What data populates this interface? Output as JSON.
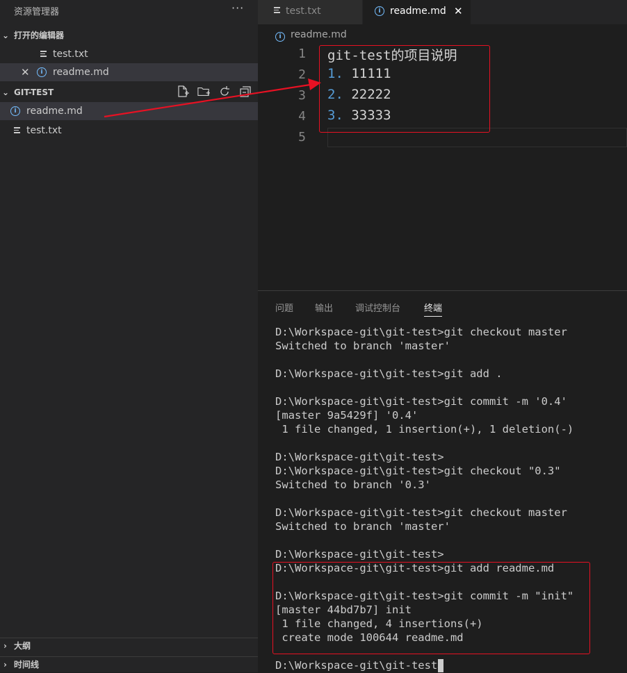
{
  "explorer": {
    "title": "资源管理器",
    "more_label": "···",
    "open_editors": {
      "header": "打开的编辑器",
      "items": [
        {
          "name": "test.txt",
          "icon": "file-lines-icon"
        },
        {
          "name": "readme.md",
          "icon": "info-icon",
          "active": true
        }
      ]
    },
    "workspace": {
      "header": "GIT-TEST",
      "files": [
        {
          "name": "readme.md",
          "icon": "info-icon"
        },
        {
          "name": "test.txt",
          "icon": "file-lines-icon"
        }
      ]
    },
    "outline": "大纲",
    "timeline": "时间线"
  },
  "editor": {
    "tabs": [
      {
        "label": "test.txt",
        "active": false
      },
      {
        "label": "readme.md",
        "active": true
      }
    ],
    "breadcrumb": "readme.md",
    "lines": [
      {
        "no": "1",
        "num": "",
        "text": "git-test的项目说明"
      },
      {
        "no": "2",
        "num": "1.",
        "text": " 11111"
      },
      {
        "no": "3",
        "num": "2.",
        "text": " 22222"
      },
      {
        "no": "4",
        "num": "3.",
        "text": " 33333"
      },
      {
        "no": "5",
        "num": "",
        "text": ""
      }
    ]
  },
  "panel": {
    "tabs": [
      "问题",
      "输出",
      "调试控制台",
      "终端"
    ],
    "terminal_lines": [
      "D:\\Workspace-git\\git-test>git checkout master",
      "Switched to branch 'master'",
      "",
      "D:\\Workspace-git\\git-test>git add .",
      "",
      "D:\\Workspace-git\\git-test>git commit -m '0.4'",
      "[master 9a5429f] '0.4'",
      " 1 file changed, 1 insertion(+), 1 deletion(-)",
      "",
      "D:\\Workspace-git\\git-test>",
      "D:\\Workspace-git\\git-test>git checkout \"0.3\"",
      "Switched to branch '0.3'",
      "",
      "D:\\Workspace-git\\git-test>git checkout master",
      "Switched to branch 'master'",
      "",
      "D:\\Workspace-git\\git-test>",
      "D:\\Workspace-git\\git-test>git add readme.md",
      "",
      "D:\\Workspace-git\\git-test>git commit -m \"init\"",
      "[master 44bd7b7] init",
      " 1 file changed, 4 insertions(+)",
      " create mode 100644 readme.md",
      "",
      "D:\\Workspace-git\\git-test>"
    ]
  },
  "colors": {
    "annotation": "#e81123",
    "list_number": "#569cd6",
    "info_icon": "#75beff"
  }
}
